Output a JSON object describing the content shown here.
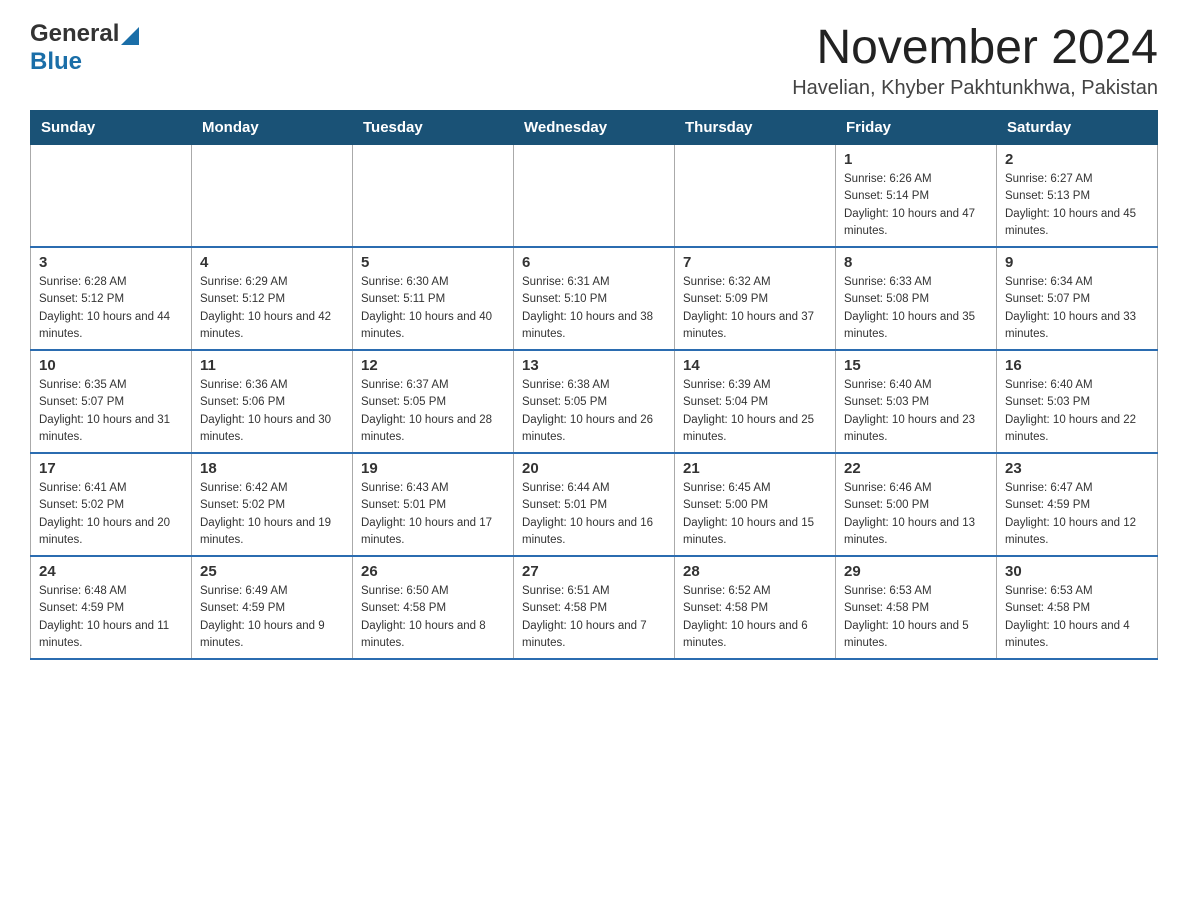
{
  "logo": {
    "word1": "General",
    "word2": "Blue"
  },
  "title": {
    "month_year": "November 2024",
    "location": "Havelian, Khyber Pakhtunkhwa, Pakistan"
  },
  "calendar": {
    "headers": [
      "Sunday",
      "Monday",
      "Tuesday",
      "Wednesday",
      "Thursday",
      "Friday",
      "Saturday"
    ],
    "rows": [
      [
        {
          "day": "",
          "info": ""
        },
        {
          "day": "",
          "info": ""
        },
        {
          "day": "",
          "info": ""
        },
        {
          "day": "",
          "info": ""
        },
        {
          "day": "",
          "info": ""
        },
        {
          "day": "1",
          "info": "Sunrise: 6:26 AM\nSunset: 5:14 PM\nDaylight: 10 hours and 47 minutes."
        },
        {
          "day": "2",
          "info": "Sunrise: 6:27 AM\nSunset: 5:13 PM\nDaylight: 10 hours and 45 minutes."
        }
      ],
      [
        {
          "day": "3",
          "info": "Sunrise: 6:28 AM\nSunset: 5:12 PM\nDaylight: 10 hours and 44 minutes."
        },
        {
          "day": "4",
          "info": "Sunrise: 6:29 AM\nSunset: 5:12 PM\nDaylight: 10 hours and 42 minutes."
        },
        {
          "day": "5",
          "info": "Sunrise: 6:30 AM\nSunset: 5:11 PM\nDaylight: 10 hours and 40 minutes."
        },
        {
          "day": "6",
          "info": "Sunrise: 6:31 AM\nSunset: 5:10 PM\nDaylight: 10 hours and 38 minutes."
        },
        {
          "day": "7",
          "info": "Sunrise: 6:32 AM\nSunset: 5:09 PM\nDaylight: 10 hours and 37 minutes."
        },
        {
          "day": "8",
          "info": "Sunrise: 6:33 AM\nSunset: 5:08 PM\nDaylight: 10 hours and 35 minutes."
        },
        {
          "day": "9",
          "info": "Sunrise: 6:34 AM\nSunset: 5:07 PM\nDaylight: 10 hours and 33 minutes."
        }
      ],
      [
        {
          "day": "10",
          "info": "Sunrise: 6:35 AM\nSunset: 5:07 PM\nDaylight: 10 hours and 31 minutes."
        },
        {
          "day": "11",
          "info": "Sunrise: 6:36 AM\nSunset: 5:06 PM\nDaylight: 10 hours and 30 minutes."
        },
        {
          "day": "12",
          "info": "Sunrise: 6:37 AM\nSunset: 5:05 PM\nDaylight: 10 hours and 28 minutes."
        },
        {
          "day": "13",
          "info": "Sunrise: 6:38 AM\nSunset: 5:05 PM\nDaylight: 10 hours and 26 minutes."
        },
        {
          "day": "14",
          "info": "Sunrise: 6:39 AM\nSunset: 5:04 PM\nDaylight: 10 hours and 25 minutes."
        },
        {
          "day": "15",
          "info": "Sunrise: 6:40 AM\nSunset: 5:03 PM\nDaylight: 10 hours and 23 minutes."
        },
        {
          "day": "16",
          "info": "Sunrise: 6:40 AM\nSunset: 5:03 PM\nDaylight: 10 hours and 22 minutes."
        }
      ],
      [
        {
          "day": "17",
          "info": "Sunrise: 6:41 AM\nSunset: 5:02 PM\nDaylight: 10 hours and 20 minutes."
        },
        {
          "day": "18",
          "info": "Sunrise: 6:42 AM\nSunset: 5:02 PM\nDaylight: 10 hours and 19 minutes."
        },
        {
          "day": "19",
          "info": "Sunrise: 6:43 AM\nSunset: 5:01 PM\nDaylight: 10 hours and 17 minutes."
        },
        {
          "day": "20",
          "info": "Sunrise: 6:44 AM\nSunset: 5:01 PM\nDaylight: 10 hours and 16 minutes."
        },
        {
          "day": "21",
          "info": "Sunrise: 6:45 AM\nSunset: 5:00 PM\nDaylight: 10 hours and 15 minutes."
        },
        {
          "day": "22",
          "info": "Sunrise: 6:46 AM\nSunset: 5:00 PM\nDaylight: 10 hours and 13 minutes."
        },
        {
          "day": "23",
          "info": "Sunrise: 6:47 AM\nSunset: 4:59 PM\nDaylight: 10 hours and 12 minutes."
        }
      ],
      [
        {
          "day": "24",
          "info": "Sunrise: 6:48 AM\nSunset: 4:59 PM\nDaylight: 10 hours and 11 minutes."
        },
        {
          "day": "25",
          "info": "Sunrise: 6:49 AM\nSunset: 4:59 PM\nDaylight: 10 hours and 9 minutes."
        },
        {
          "day": "26",
          "info": "Sunrise: 6:50 AM\nSunset: 4:58 PM\nDaylight: 10 hours and 8 minutes."
        },
        {
          "day": "27",
          "info": "Sunrise: 6:51 AM\nSunset: 4:58 PM\nDaylight: 10 hours and 7 minutes."
        },
        {
          "day": "28",
          "info": "Sunrise: 6:52 AM\nSunset: 4:58 PM\nDaylight: 10 hours and 6 minutes."
        },
        {
          "day": "29",
          "info": "Sunrise: 6:53 AM\nSunset: 4:58 PM\nDaylight: 10 hours and 5 minutes."
        },
        {
          "day": "30",
          "info": "Sunrise: 6:53 AM\nSunset: 4:58 PM\nDaylight: 10 hours and 4 minutes."
        }
      ]
    ]
  }
}
